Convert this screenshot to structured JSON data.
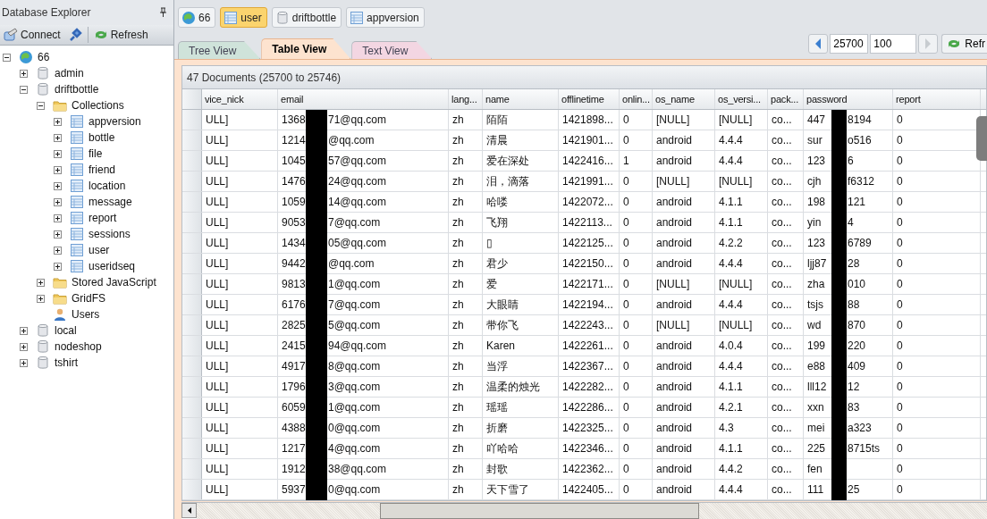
{
  "sidebar": {
    "title": "Database Explorer",
    "toolbar": [
      {
        "kind": "connect",
        "label": "Connect"
      },
      {
        "kind": "plug"
      },
      {
        "kind": "refresh",
        "label": "Refresh"
      }
    ],
    "tree": [
      {
        "kind": "server",
        "label": "66",
        "expanded": true,
        "children": [
          {
            "kind": "database",
            "label": "admin",
            "expanded": false
          },
          {
            "kind": "database",
            "label": "driftbottle",
            "expanded": true,
            "children": [
              {
                "kind": "folder",
                "label": "Collections",
                "expanded": true,
                "children": [
                  {
                    "kind": "collection",
                    "label": "appversion",
                    "expanded": false
                  },
                  {
                    "kind": "collection",
                    "label": "bottle",
                    "expanded": false
                  },
                  {
                    "kind": "collection",
                    "label": "file",
                    "expanded": false
                  },
                  {
                    "kind": "collection",
                    "label": "friend",
                    "expanded": false
                  },
                  {
                    "kind": "collection",
                    "label": "location",
                    "expanded": false
                  },
                  {
                    "kind": "collection",
                    "label": "message",
                    "expanded": false
                  },
                  {
                    "kind": "collection",
                    "label": "report",
                    "expanded": false
                  },
                  {
                    "kind": "collection",
                    "label": "sessions",
                    "expanded": false
                  },
                  {
                    "kind": "collection",
                    "label": "user",
                    "expanded": false
                  },
                  {
                    "kind": "collection",
                    "label": "useridseq",
                    "expanded": false
                  }
                ]
              },
              {
                "kind": "folder",
                "label": "Stored JavaScript",
                "expanded": false
              },
              {
                "kind": "folder",
                "label": "GridFS",
                "expanded": false
              },
              {
                "kind": "users",
                "label": "Users"
              }
            ]
          },
          {
            "kind": "database",
            "label": "local",
            "expanded": false
          },
          {
            "kind": "database",
            "label": "nodeshop",
            "expanded": false
          },
          {
            "kind": "database",
            "label": "tshirt",
            "expanded": false
          }
        ]
      }
    ]
  },
  "breadcrumbs": [
    {
      "kind": "server",
      "label": "66",
      "selected": false
    },
    {
      "kind": "collection",
      "label": "user",
      "selected": true
    },
    {
      "kind": "database",
      "label": "driftbottle",
      "selected": false
    },
    {
      "kind": "collection",
      "label": "appversion",
      "selected": false
    }
  ],
  "view_tabs": [
    {
      "label": "Tree View",
      "selected": false,
      "color": "#cfe3da"
    },
    {
      "label": "Table View",
      "selected": true,
      "color": "#fde3cf"
    },
    {
      "label": "Text View",
      "selected": false,
      "color": "#f3d6e2"
    }
  ],
  "pager": {
    "skip": "25700",
    "limit": "100",
    "refresh": "Refr"
  },
  "summary": "47 Documents (25700 to 25746)",
  "columns": [
    "vice_nick",
    "email",
    "lang...",
    "name",
    "offlinetime",
    "onlin...",
    "os_name",
    "os_versi...",
    "pack...",
    "password",
    "report"
  ],
  "rows": [
    {
      "vice_nick": "ULL]",
      "email_start": "1368",
      "email_end": "71@qq.com",
      "lang": "zh",
      "name": "陌陌",
      "offlinetime": "1421898...",
      "online": "0",
      "os_name": "[NULL]",
      "os_version": "[NULL]",
      "package": "co...",
      "password_start": "447",
      "password_end": "8194",
      "report": "0"
    },
    {
      "vice_nick": "ULL]",
      "email_start": "1214",
      "email_end": "@qq.com",
      "lang": "zh",
      "name": "清晨",
      "offlinetime": "1421901...",
      "online": "0",
      "os_name": "android",
      "os_version": "4.4.4",
      "package": "co...",
      "password_start": "sur",
      "password_end": "o516",
      "report": "0"
    },
    {
      "vice_nick": "ULL]",
      "email_start": "1045",
      "email_end": "57@qq.com",
      "lang": "zh",
      "name": "爱在深处",
      "offlinetime": "1422416...",
      "online": "1",
      "os_name": "android",
      "os_version": "4.4.4",
      "package": "co...",
      "password_start": "123",
      "password_end": "6",
      "report": "0"
    },
    {
      "vice_nick": "ULL]",
      "email_start": "1476",
      "email_end": "24@qq.com",
      "lang": "zh",
      "name": "泪，滴落",
      "offlinetime": "1421991...",
      "online": "0",
      "os_name": "[NULL]",
      "os_version": "[NULL]",
      "package": "co...",
      "password_start": "cjh",
      "password_end": "f6312",
      "report": "0"
    },
    {
      "vice_nick": "ULL]",
      "email_start": "1059",
      "email_end": "14@qq.com",
      "lang": "zh",
      "name": "哈喽",
      "offlinetime": "1422072...",
      "online": "0",
      "os_name": "android",
      "os_version": "4.1.1",
      "package": "co...",
      "password_start": "198",
      "password_end": "121",
      "report": "0"
    },
    {
      "vice_nick": "ULL]",
      "email_start": "9053",
      "email_end": "7@qq.com",
      "lang": "zh",
      "name": "飞翔",
      "offlinetime": "1422113...",
      "online": "0",
      "os_name": "android",
      "os_version": "4.1.1",
      "package": "co...",
      "password_start": "yin",
      "password_end": "4",
      "report": "0"
    },
    {
      "vice_nick": "ULL]",
      "email_start": "1434",
      "email_end": "05@qq.com",
      "lang": "zh",
      "name": "▯",
      "offlinetime": "1422125...",
      "online": "0",
      "os_name": "android",
      "os_version": "4.2.2",
      "package": "co...",
      "password_start": "123",
      "password_end": "6789",
      "report": "0"
    },
    {
      "vice_nick": "ULL]",
      "email_start": "9442",
      "email_end": "@qq.com",
      "lang": "zh",
      "name": "君少",
      "offlinetime": "1422150...",
      "online": "0",
      "os_name": "android",
      "os_version": "4.4.4",
      "package": "co...",
      "password_start": "ljj87",
      "password_end": "28",
      "report": "0"
    },
    {
      "vice_nick": "ULL]",
      "email_start": "9813",
      "email_end": "1@qq.com",
      "lang": "zh",
      "name": "爱",
      "offlinetime": "1422171...",
      "online": "0",
      "os_name": "[NULL]",
      "os_version": "[NULL]",
      "package": "co...",
      "password_start": "zha",
      "password_end": "010",
      "report": "0"
    },
    {
      "vice_nick": "ULL]",
      "email_start": "6176",
      "email_end": "7@qq.com",
      "lang": "zh",
      "name": "大眼睛",
      "offlinetime": "1422194...",
      "online": "0",
      "os_name": "android",
      "os_version": "4.4.4",
      "package": "co...",
      "password_start": "tsjs",
      "password_end": "88",
      "report": "0"
    },
    {
      "vice_nick": "ULL]",
      "email_start": "2825",
      "email_end": "5@qq.com",
      "lang": "zh",
      "name": "带你飞",
      "offlinetime": "1422243...",
      "online": "0",
      "os_name": "[NULL]",
      "os_version": "[NULL]",
      "package": "co...",
      "password_start": "wd",
      "password_end": "870",
      "report": "0"
    },
    {
      "vice_nick": "ULL]",
      "email_start": "2415",
      "email_end": "94@qq.com",
      "lang": "zh",
      "name": "Karen",
      "offlinetime": "1422261...",
      "online": "0",
      "os_name": "android",
      "os_version": "4.0.4",
      "package": "co...",
      "password_start": "199",
      "password_end": "220",
      "report": "0"
    },
    {
      "vice_nick": "ULL]",
      "email_start": "4917",
      "email_end": "8@qq.com",
      "lang": "zh",
      "name": "当浮",
      "offlinetime": "1422367...",
      "online": "0",
      "os_name": "android",
      "os_version": "4.4.4",
      "package": "co...",
      "password_start": "e88",
      "password_end": "409",
      "report": "0"
    },
    {
      "vice_nick": "ULL]",
      "email_start": "1796",
      "email_end": "3@qq.com",
      "lang": "zh",
      "name": "温柔的烛光",
      "offlinetime": "1422282...",
      "online": "0",
      "os_name": "android",
      "os_version": "4.1.1",
      "package": "co...",
      "password_start": "lll12",
      "password_end": "12",
      "report": "0"
    },
    {
      "vice_nick": "ULL]",
      "email_start": "6059",
      "email_end": "1@qq.com",
      "lang": "zh",
      "name": "瑶瑶",
      "offlinetime": "1422286...",
      "online": "0",
      "os_name": "android",
      "os_version": "4.2.1",
      "package": "co...",
      "password_start": "xxn",
      "password_end": "83",
      "report": "0"
    },
    {
      "vice_nick": "ULL]",
      "email_start": "4388",
      "email_end": "0@qq.com",
      "lang": "zh",
      "name": "折磨",
      "offlinetime": "1422325...",
      "online": "0",
      "os_name": "android",
      "os_version": "4.3",
      "package": "co...",
      "password_start": "mei",
      "password_end": "a323",
      "report": "0"
    },
    {
      "vice_nick": "ULL]",
      "email_start": "1217",
      "email_end": "4@qq.com",
      "lang": "zh",
      "name": "吖哈哈",
      "offlinetime": "1422346...",
      "online": "0",
      "os_name": "android",
      "os_version": "4.1.1",
      "package": "co...",
      "password_start": "225",
      "password_end": "8715ts",
      "report": "0"
    },
    {
      "vice_nick": "ULL]",
      "email_start": "1912",
      "email_end": "38@qq.com",
      "lang": "zh",
      "name": "封歌",
      "offlinetime": "1422362...",
      "online": "0",
      "os_name": "android",
      "os_version": "4.4.2",
      "package": "co...",
      "password_start": "fen",
      "report": "0"
    },
    {
      "vice_nick": "ULL]",
      "email_start": "5937",
      "email_end": "0@qq.com",
      "lang": "zh",
      "name": "天下雪了",
      "offlinetime": "1422405...",
      "online": "0",
      "os_name": "android",
      "os_version": "4.4.4",
      "package": "co...",
      "password_start": "111",
      "password_end": "25",
      "report": "0"
    }
  ]
}
